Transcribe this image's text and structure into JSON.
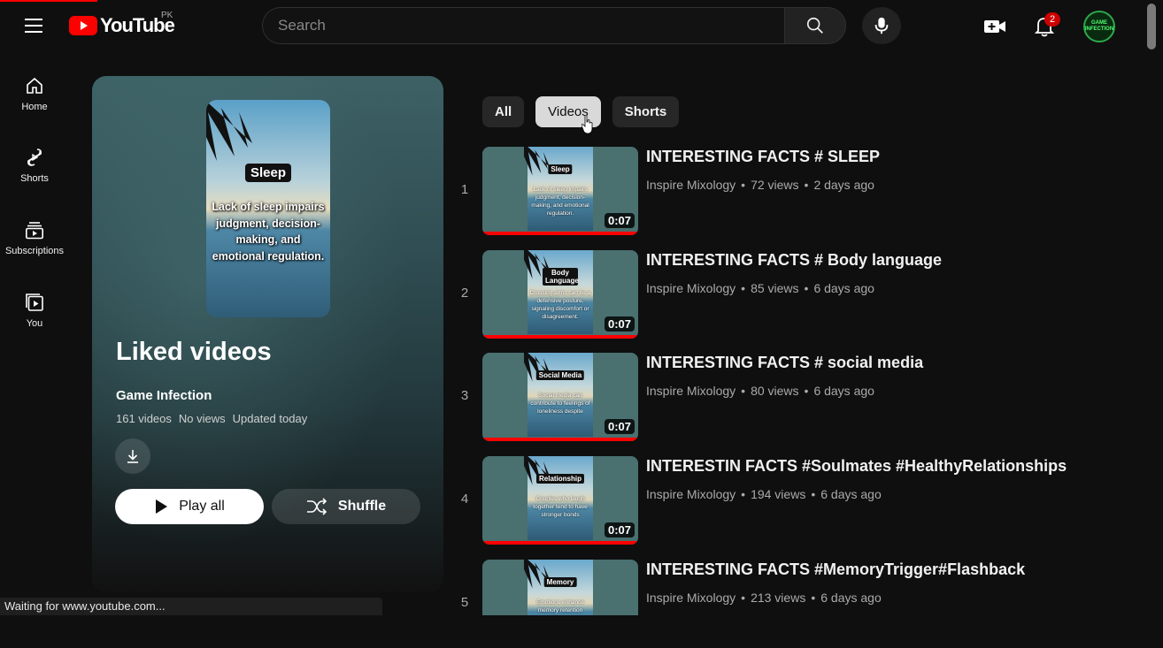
{
  "header": {
    "logo_text": "YouTube",
    "country_code": "PK",
    "search_placeholder": "Search",
    "notification_count": "2",
    "avatar_text": "GAME INFECTION",
    "brand_color": "#ff0000"
  },
  "sidebar": {
    "items": [
      {
        "label": "Home",
        "icon": "home-icon"
      },
      {
        "label": "Shorts",
        "icon": "shorts-icon"
      },
      {
        "label": "Subscriptions",
        "icon": "subscriptions-icon"
      },
      {
        "label": "You",
        "icon": "you-icon"
      }
    ]
  },
  "playlist": {
    "thumb_title": "Sleep",
    "thumb_text": "Lack of sleep impairs judgment, decision-making, and emotional regulation.",
    "title": "Liked videos",
    "owner": "Game Infection",
    "video_count": "161 videos",
    "views": "No views",
    "updated": "Updated today",
    "play_all_label": "Play all",
    "shuffle_label": "Shuffle"
  },
  "chips": [
    {
      "label": "All",
      "state": "active"
    },
    {
      "label": "Videos",
      "state": "hover"
    },
    {
      "label": "Shorts",
      "state": "normal"
    }
  ],
  "videos": [
    {
      "index": "1",
      "title": "INTERESTING FACTS # SLEEP",
      "channel": "Inspire Mixology",
      "views": "72 views",
      "age": "2 days ago",
      "duration": "0:07",
      "thumb_label": "Sleep",
      "thumb_text": "Lack of sleep impairs judgment, decision-making, and emotional regulation."
    },
    {
      "index": "2",
      "title": "INTERESTING FACTS # Body language",
      "channel": "Inspire Mixology",
      "views": "85 views",
      "age": "6 days ago",
      "duration": "0:07",
      "thumb_label": "Body Language",
      "thumb_text": "Crossing arms can be a defensive posture, signaling discomfort or disagreement."
    },
    {
      "index": "3",
      "title": "INTERESTING FACTS # social media",
      "channel": "Inspire Mixology",
      "views": "80 views",
      "age": "6 days ago",
      "duration": "0:07",
      "thumb_label": "Social Media",
      "thumb_text": "Social media can contribute to feelings of loneliness despite"
    },
    {
      "index": "4",
      "title": "INTERESTIN FACTS #Soulmates #HealthyRelationships",
      "channel": "Inspire Mixology",
      "views": "194 views",
      "age": "6 days ago",
      "duration": "0:07",
      "thumb_label": "Relationship",
      "thumb_text": "Couples who laugh together tend to have stronger bonds"
    },
    {
      "index": "5",
      "title": "INTERESTING FACTS #MemoryTrigger#Flashback",
      "channel": "Inspire Mixology",
      "views": "213 views",
      "age": "6 days ago",
      "duration": "",
      "thumb_label": "Memory",
      "thumb_text": "Emotions enhance memory retention"
    }
  ],
  "status_text": "Waiting for www.youtube.com..."
}
